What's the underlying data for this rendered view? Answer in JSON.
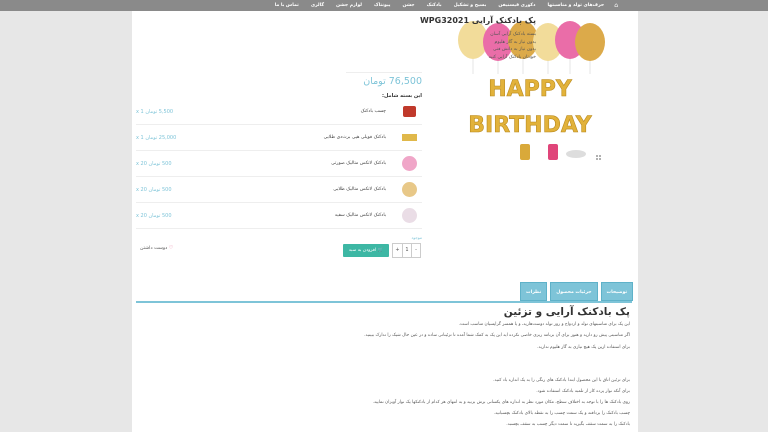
{
  "nav": {
    "home_icon": "home-icon",
    "items": [
      "حرف‌های تولد و مناسبتها",
      "دکوری فیسنیفن",
      "بسیح و تشکیل",
      "بادکنک",
      "جشن",
      "پیونتاک",
      "لوازم جشن",
      "گالری",
      "تماس با ما"
    ]
  },
  "product": {
    "title": "پک بادکنک آرایی WPG32021",
    "description": [
      "بسته بادکنک آرایی آسان",
      "بدون نیاز به گاز هلیوم",
      "بدون نیاز به دانش فنی",
      "خودتان بادکنک آرایی کنید"
    ],
    "price": "76,500 تومان",
    "bundle_heading": "این بسته شامل:",
    "stock": "موجود",
    "qty_value": "1",
    "qty_minus": "-",
    "qty_plus": "+",
    "add_to_cart": "افزودن به سبد",
    "wishlist": "دوست داشتن",
    "image_text_line1": "HAPPY",
    "image_text_line2": "BIRTHDAY"
  },
  "bundle": [
    {
      "name": "چسب بادکنک",
      "price": "5,500 تومان x 1",
      "thumb_color": "#c0392b"
    },
    {
      "name": "بادکنک فویلی هپی برث‌دی طلایی",
      "price": "25,000 تومان x 1",
      "thumb_color": "#e0b84a"
    },
    {
      "name": "بادکنک لاتکس متالیک صورتی",
      "price": "500 تومان x 20",
      "thumb_color": "#f0a6c8"
    },
    {
      "name": "بادکنک لاتکس متالیک طلایی",
      "price": "500 تومان x 20",
      "thumb_color": "#e8c888"
    },
    {
      "name": "بادکنک لاتکس متالیک سفید",
      "price": "500 تومان x 20",
      "thumb_color": "#eadde6"
    }
  ],
  "tabs": [
    "توضیحات",
    "جزئیات محصول",
    "نظرات"
  ],
  "content": {
    "heading": "پک بادکنک آرایی و تزئین",
    "paragraphs": [
      "این پک برای مناسبتهای تولد و ازدواج و روز تولد دوست‌هارید، و یا همسر گزاپسیان مناسب است.",
      "اگر مناسبتی پیش رو دارید و هنوز برای آن برنامه ریزی خاصی نکرده اید این پک به کمک شما آمده تا تزئیناتی ساده و در عین حال شیک را تدارک ببینید.",
      "برای استفاده ازین پک هیچ نیازی به گاز هلیوم ندارید.",
      "برای تزئین اتاق با این محصول ابتدا بادکنک های رنگی را به یک اندازه باد کنید.",
      "برای آنکه نوار پرده کار از تلمبه بادکنک استفاده شود.",
      "روی بادکنک ها را با توجه به اختلاف سطح، مکان مورد نظر به اندازه های یکسانی برش بزنید و به انتهای هر کدام از بادکنکها یک نوار آویزان نمایید.",
      "چسب بادکنک را بردافته و یک سمت چسب را به نقطه بالای بادکنک بچسبانید.",
      "بادکنک را به سمت سقف بگیرید تا سمت دیگر چسب به سقف بچسبد."
    ]
  },
  "colors": {
    "accent": "#7ec4d8",
    "button": "#3db7a4",
    "topbar": "#8a8a8a"
  }
}
